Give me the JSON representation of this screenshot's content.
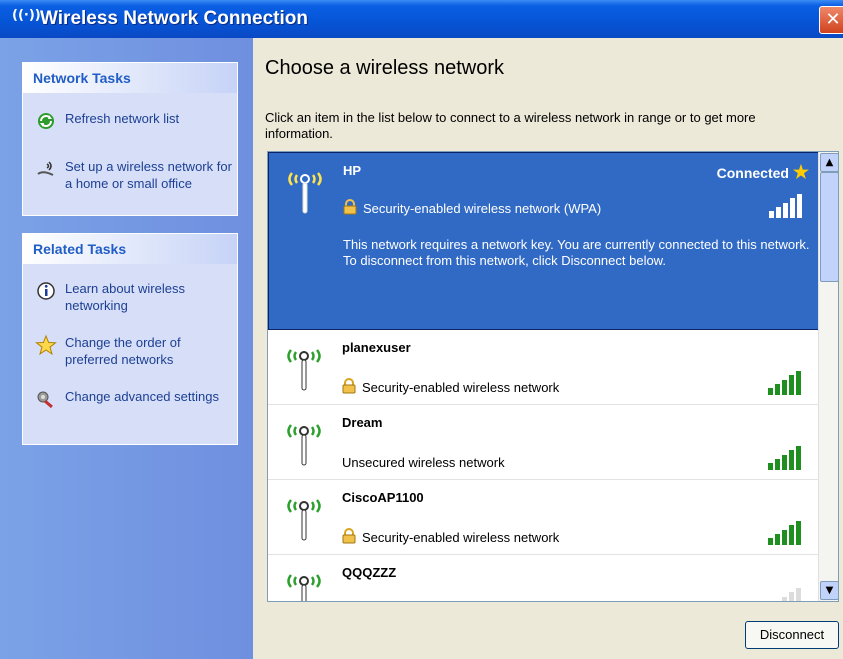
{
  "window": {
    "title": "Wireless Network Connection",
    "title_icon": "((·))",
    "close_label": "✕"
  },
  "left": {
    "network_tasks": {
      "header": "Network Tasks",
      "items": [
        {
          "label": "Refresh network list",
          "icon": "refresh-icon"
        },
        {
          "label": "Set up a wireless network for a home or small office",
          "icon": "wireless-setup-icon"
        }
      ]
    },
    "related_tasks": {
      "header": "Related Tasks",
      "items": [
        {
          "label": "Learn about wireless networking",
          "icon": "info-icon"
        },
        {
          "label": "Change the order of preferred networks",
          "icon": "star-icon"
        },
        {
          "label": "Change advanced settings",
          "icon": "settings-icon"
        }
      ]
    }
  },
  "main": {
    "heading": "Choose a wireless network",
    "instructions": "Click an item in the list below to connect to a wireless network in range or to get more information.",
    "networks": [
      {
        "name": "HP",
        "status": "Connected",
        "security": "Security-enabled wireless network (WPA)",
        "description": "This network requires a network key. You are currently connected to this network. To disconnect from this network, click Disconnect below.",
        "signal_bars": 5,
        "selected": true
      },
      {
        "name": "planexuser",
        "security": "Security-enabled wireless network",
        "signal_bars": 5
      },
      {
        "name": "Dream",
        "security": "Unsecured wireless network",
        "signal_bars": 5
      },
      {
        "name": "CiscoAP1100",
        "security": "Security-enabled wireless network",
        "signal_bars": 5
      },
      {
        "name": "QQQZZZ",
        "security": "",
        "signal_bars": 2
      }
    ],
    "disconnect_label": "Disconnect"
  },
  "colors": {
    "titlebar": "#0654d6",
    "selection": "#316ac5",
    "signal_green": "#1f8f1f",
    "task_link": "#215dc6"
  }
}
